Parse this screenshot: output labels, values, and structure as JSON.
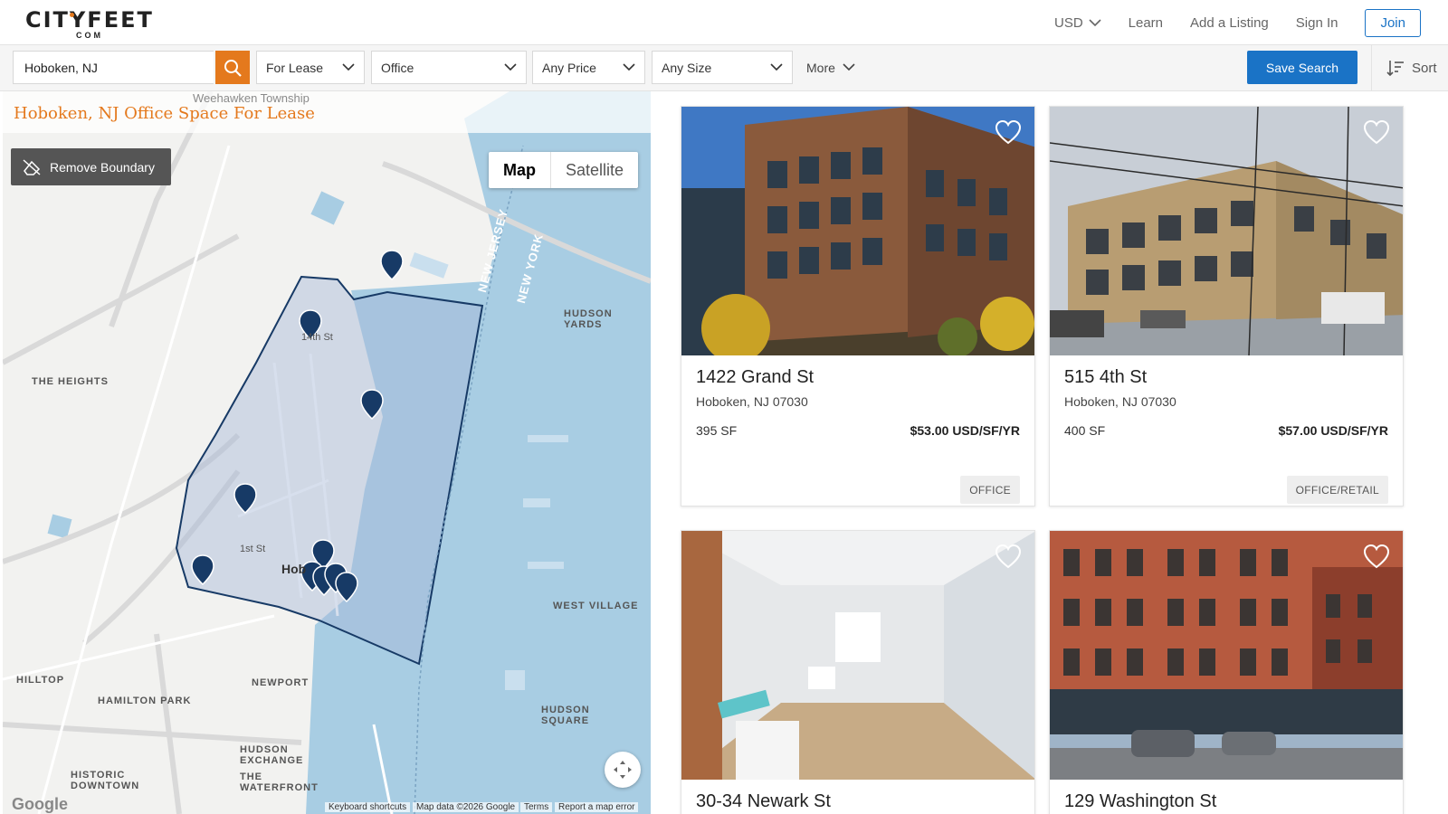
{
  "header": {
    "logo_top": "CITYFEET",
    "logo_bottom": "COM",
    "nav": {
      "currency": "USD",
      "learn": "Learn",
      "add_listing": "Add a Listing",
      "sign_in": "Sign In",
      "join": "Join"
    }
  },
  "filters": {
    "location": "Hoboken, NJ",
    "lease_type": "For Lease",
    "property_type": "Office",
    "price": "Any Price",
    "size": "Any Size",
    "more": "More",
    "save_search": "Save Search",
    "sort": "Sort"
  },
  "map": {
    "title": "Hoboken, NJ Office Space For Lease",
    "remove_boundary": "Remove Boundary",
    "type_map": "Map",
    "type_satellite": "Satellite",
    "labels": {
      "the_heights": "THE HEIGHTS",
      "hudson_yards": "HUDSON YARDS",
      "west_village": "WEST VILLAGE",
      "hilltop": "HILLTOP",
      "hamilton_park": "HAMILTON PARK",
      "newport": "NEWPORT",
      "hudson_square": "HUDSON SQUARE",
      "hudson_exchange": "HUDSON EXCHANGE",
      "the_waterfront": "THE WATERFRONT",
      "historic_downtown": "HISTORIC DOWNTOWN",
      "new_jersey": "NEW JERSEY",
      "new_york": "NEW YORK",
      "weehawken": "Weehawken Township",
      "hoboken": "Hob",
      "fourteenth_st": "14th St",
      "first_st": "1st St"
    },
    "footer": {
      "google": "Google",
      "shortcuts": "Keyboard shortcuts",
      "data": "Map data ©2026 Google",
      "terms": "Terms",
      "report": "Report a map error"
    }
  },
  "listings": [
    {
      "address": "1422 Grand St",
      "city": "Hoboken, NJ 07030",
      "size": "395 SF",
      "price": "$53.00 USD/SF/YR",
      "type": "OFFICE"
    },
    {
      "address": "515 4th St",
      "city": "Hoboken, NJ 07030",
      "size": "400 SF",
      "price": "$57.00 USD/SF/YR",
      "type": "OFFICE/RETAIL"
    },
    {
      "address": "30-34 Newark St"
    },
    {
      "address": "129 Washington St"
    }
  ],
  "colors": {
    "brand_orange": "#e4791d",
    "brand_blue": "#1a73c6",
    "water": "#a8cde3",
    "pin": "#173a66"
  }
}
